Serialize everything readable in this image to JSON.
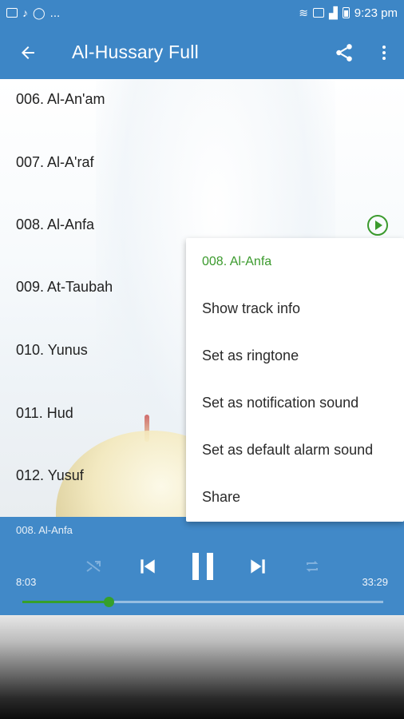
{
  "status_bar": {
    "left_icons": [
      "image-icon",
      "music-note-icon",
      "whatsapp-icon"
    ],
    "overflow": "...",
    "right_icons": [
      "wifi-icon",
      "sim-icon",
      "signal-icon",
      "battery-icon"
    ],
    "time": "9:23 pm"
  },
  "app_bar": {
    "title": "Al-Hussary Full",
    "back_icon": "arrow-left-icon",
    "share_icon": "share-icon",
    "more_icon": "more-vert-icon"
  },
  "tracks": [
    {
      "label": "006. Al-An'am"
    },
    {
      "label": "007. Al-A'raf"
    },
    {
      "label": "008. Al-Anfa",
      "playing": true
    },
    {
      "label": "009. At-Taubah"
    },
    {
      "label": "010. Yunus"
    },
    {
      "label": "011. Hud"
    },
    {
      "label": "012. Yusuf"
    }
  ],
  "context_menu": {
    "header": "008. Al-Anfa",
    "items": [
      {
        "label": "Show track info"
      },
      {
        "label": "Set as ringtone"
      },
      {
        "label": "Set as notification sound"
      },
      {
        "label": "Set as default alarm sound"
      },
      {
        "label": "Share"
      }
    ]
  },
  "player": {
    "now_playing": "008. Al-Anfa",
    "elapsed": "8:03",
    "duration": "33:29",
    "progress_fraction": 0.24,
    "controls": [
      "shuffle-icon",
      "previous-icon",
      "pause-icon",
      "next-icon",
      "repeat-icon"
    ]
  },
  "colors": {
    "primary": "#3d86c6",
    "player": "#4189c8",
    "accent_green": "#3b9a2d"
  }
}
